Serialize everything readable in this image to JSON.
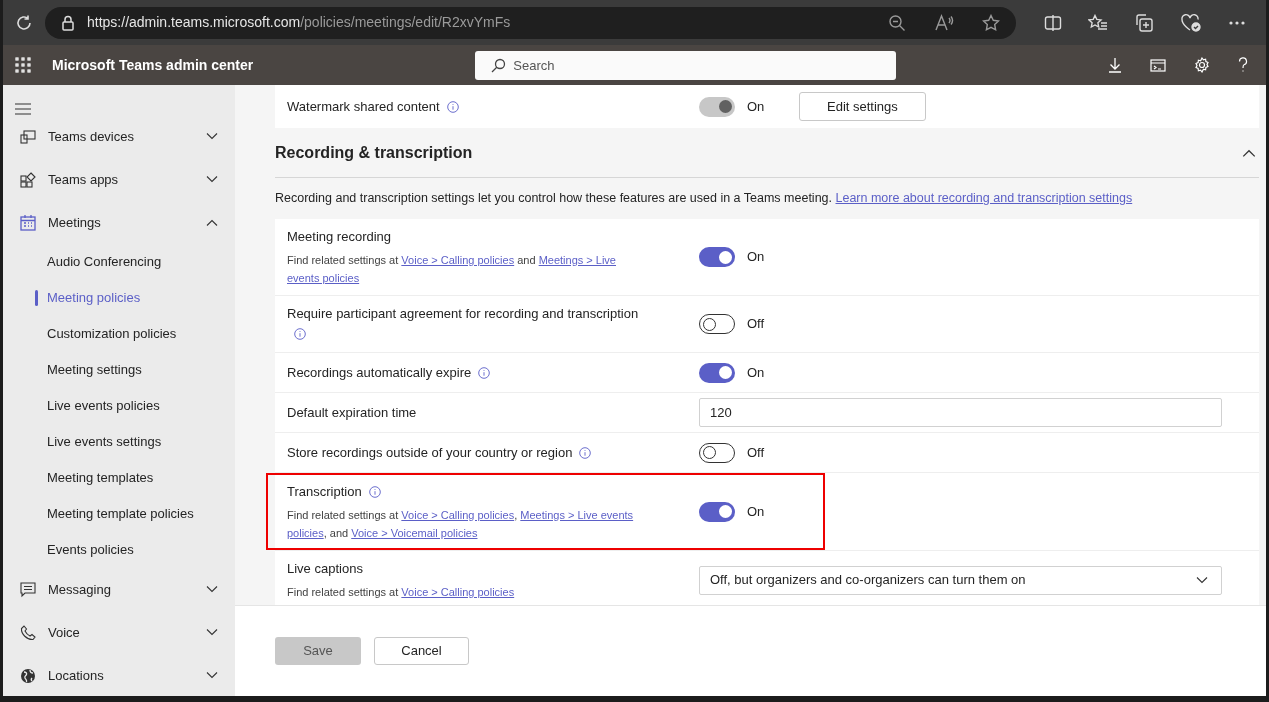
{
  "browser": {
    "url_host": "https://admin.teams.microsoft.com",
    "url_path": "/policies/meetings/edit/R2xvYmFs"
  },
  "app": {
    "title": "Microsoft Teams admin center",
    "search": {
      "placeholder": "Search"
    }
  },
  "sidebar": {
    "items": [
      {
        "label": "Teams devices",
        "expanded": false
      },
      {
        "label": "Teams apps",
        "expanded": false
      },
      {
        "label": "Meetings",
        "expanded": true,
        "children": [
          {
            "label": "Audio Conferencing",
            "selected": false
          },
          {
            "label": "Meeting policies",
            "selected": true
          },
          {
            "label": "Customization policies",
            "selected": false
          },
          {
            "label": "Meeting settings",
            "selected": false
          },
          {
            "label": "Live events policies",
            "selected": false
          },
          {
            "label": "Live events settings",
            "selected": false
          },
          {
            "label": "Meeting templates",
            "selected": false
          },
          {
            "label": "Meeting template policies",
            "selected": false
          },
          {
            "label": "Events policies",
            "selected": false
          }
        ]
      },
      {
        "label": "Messaging",
        "expanded": false
      },
      {
        "label": "Voice",
        "expanded": false
      },
      {
        "label": "Locations",
        "expanded": false
      }
    ]
  },
  "watermark_row": {
    "label": "Watermark shared content",
    "info": true,
    "on": true,
    "disabled": true,
    "state_label": "On",
    "button": "Edit settings"
  },
  "section": {
    "title": "Recording & transcription",
    "expanded": true,
    "description": [
      {
        "kind": "text",
        "text": "Recording and transcription settings let you control how these features are used in a Teams meeting. "
      },
      {
        "kind": "link",
        "text": "Learn more about recording and transcription settings"
      }
    ],
    "rows": [
      {
        "kind": "toggle",
        "label": "Meeting recording",
        "on": true,
        "state_label": "On",
        "description": [
          {
            "kind": "text",
            "text": "Find related settings at "
          },
          {
            "kind": "link",
            "text": "Voice > Calling policies"
          },
          {
            "kind": "text",
            "text": " and "
          },
          {
            "kind": "link",
            "text": "Meetings > Live"
          },
          {
            "kind": "link",
            "text": "events policies"
          }
        ]
      },
      {
        "kind": "toggle",
        "label": "Require participant agreement for recording and transcription",
        "info": true,
        "on": false,
        "state_label": "Off"
      },
      {
        "kind": "toggle",
        "label": "Recordings automatically expire",
        "info": true,
        "on": true,
        "state_label": "On"
      },
      {
        "kind": "number",
        "label": "Default expiration time",
        "value": "120"
      },
      {
        "kind": "toggle",
        "label": "Store recordings outside of your country or region",
        "info": true,
        "on": false,
        "state_label": "Off"
      },
      {
        "kind": "toggle",
        "label": "Transcription",
        "info": true,
        "on": true,
        "state_label": "On",
        "highlighted": true,
        "description": [
          {
            "kind": "text",
            "text": "Find related settings at "
          },
          {
            "kind": "link",
            "text": "Voice > Calling policies"
          },
          {
            "kind": "text",
            "text": ", "
          },
          {
            "kind": "link",
            "text": "Meetings > Live events"
          },
          {
            "kind": "link",
            "text": "policies"
          },
          {
            "kind": "text",
            "text": ", and "
          },
          {
            "kind": "link",
            "text": "Voice > Voicemail policies"
          }
        ]
      },
      {
        "kind": "dropdown",
        "label": "Live captions",
        "value": "Off, but organizers and co-organizers can turn them on",
        "description": [
          {
            "kind": "text",
            "text": "Find related settings at "
          },
          {
            "kind": "link",
            "text": "Voice > Calling policies"
          }
        ]
      }
    ]
  },
  "footer": {
    "buttons": [
      {
        "label": "Save",
        "disabled": true
      },
      {
        "label": "Cancel",
        "disabled": false
      }
    ]
  }
}
